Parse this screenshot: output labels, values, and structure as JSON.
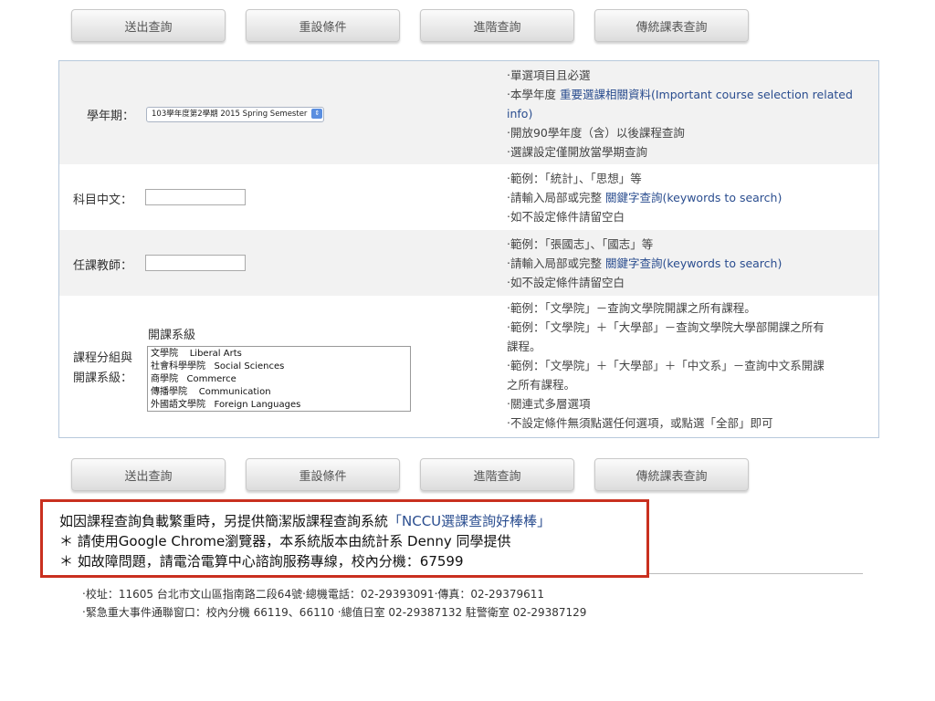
{
  "buttons": {
    "submit": "送出查詢",
    "reset": "重設條件",
    "advanced": "進階查詢",
    "traditional": "傳統課表查詢"
  },
  "semester": {
    "label": "學年期：",
    "selected": "103學年度第2學期 2015 Spring Semester",
    "notes": {
      "l1": "‧單選項目且必選",
      "l2_prefix": "‧本學年度 ",
      "l2_link": "重要選課相關資料(Important course selection related info)",
      "l3": "‧開放90學年度（含）以後課程查詢",
      "l4": "‧選課設定僅開放當學期查詢"
    }
  },
  "course_name": {
    "label": "科目中文：",
    "value": "",
    "notes": {
      "l1": "‧範例：「統計」、「思想」等",
      "l2_prefix": "‧請輸入局部或完整 ",
      "l2_link": "關鍵字查詢(keywords to search)",
      "l3": "‧如不設定條件請留空白"
    }
  },
  "teacher": {
    "label": "任課教師：",
    "value": "",
    "notes": {
      "l1": "‧範例：「張國志」、「國志」等",
      "l2_prefix": "‧請輸入局部或完整 ",
      "l2_link": "關鍵字查詢(keywords to search)",
      "l3": "‧如不設定條件請留空白"
    }
  },
  "dept": {
    "label_line1": "課程分組與",
    "label_line2": "開課系級：",
    "sublabel": "開課系級",
    "options": [
      {
        "zh": "文學院",
        "en": "Liberal Arts"
      },
      {
        "zh": "社會科學學院",
        "en": "Social Sciences"
      },
      {
        "zh": "商學院",
        "en": "Commerce"
      },
      {
        "zh": "傳播學院",
        "en": "Communication"
      },
      {
        "zh": "外國語文學院",
        "en": "Foreign Languages"
      }
    ],
    "notes": {
      "l1": "‧範例：「文學院」－查詢文學院開課之所有課程。",
      "l2": "‧範例：「文學院」＋「大學部」－查詢文學院大學部開課之所有",
      "l2b": "課程。",
      "l3": "‧範例：「文學院」＋「大學部」＋「中文系」－查詢中文系開課",
      "l3b": "之所有課程。",
      "l4": "‧關連式多層選項",
      "l5": "‧不設定條件無須點選任何選項，或點選「全部」即可"
    }
  },
  "notice": {
    "line1_prefix": "如因課程查詢負載繁重時，另提供簡潔版課程查詢系統",
    "line1_link": "「NCCU選課查詢好棒棒」",
    "line2": "＊ 請使用Google Chrome瀏覽器，本系統版本由統計系 Denny 同學提供",
    "line3": "＊ 如故障問題，請電洽電算中心諮詢服務專線，校內分機：67599"
  },
  "footer": {
    "line1": "‧校址：11605 台北市文山區指南路二段64號‧總機電話：02-29393091‧傳真：02-29379611",
    "line2": "‧緊急重大事件通聯窗口：校內分機 66119、66110 ‧總值日室 02-29387132 駐警衛室 02-29387129"
  },
  "colors": {
    "link": "#2a4d8f",
    "notice_border": "#c9301f",
    "panel_border": "#b8c9dc",
    "row_shade": "#f2f2f2"
  }
}
